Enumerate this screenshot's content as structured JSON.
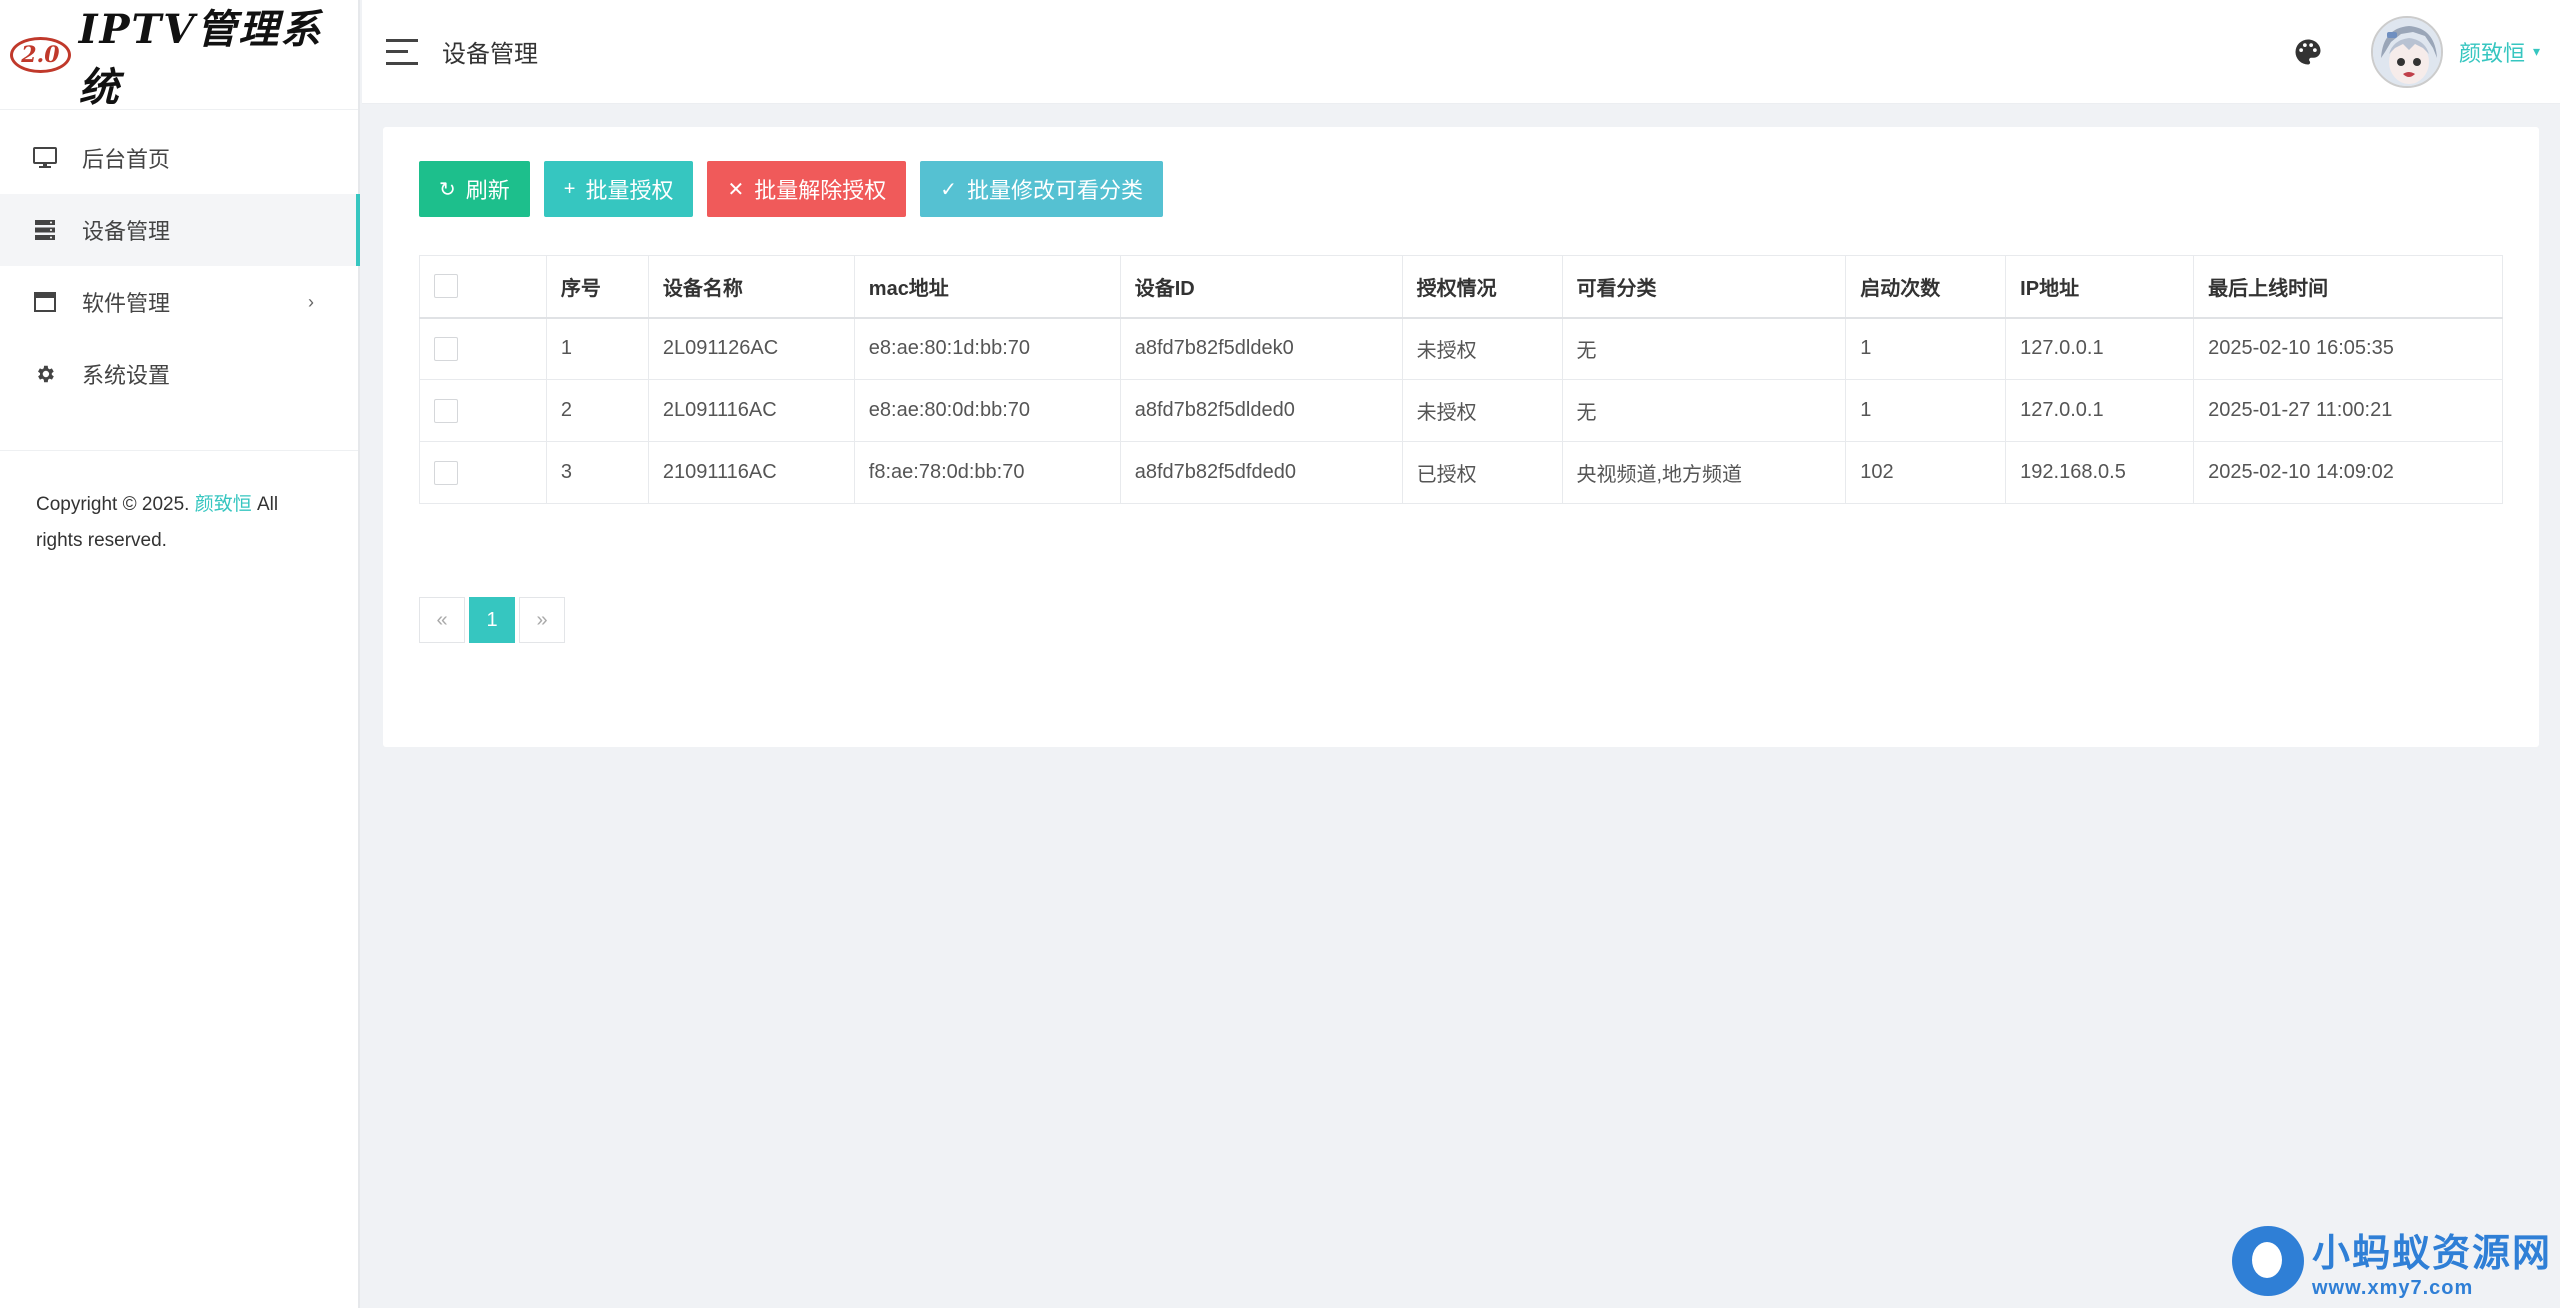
{
  "app": {
    "logo_badge": "2.0",
    "logo_text": "IPTV管理系统"
  },
  "sidebar": {
    "items": [
      {
        "label": "后台首页",
        "icon": "monitor-icon"
      },
      {
        "label": "设备管理",
        "icon": "server-icon",
        "active": true
      },
      {
        "label": "软件管理",
        "icon": "window-icon",
        "has_submenu": true
      },
      {
        "label": "系统设置",
        "icon": "gear-icon"
      }
    ],
    "submenu_caret": "›",
    "copyright_prefix": "Copyright © 2025.",
    "copyright_author": "颜致恒",
    "copyright_suffix": "All rights reserved."
  },
  "header": {
    "page_title": "设备管理",
    "user_name": "颜致恒",
    "user_caret": "▾"
  },
  "toolbar": {
    "refresh_icon": "↻",
    "refresh_label": "刷新",
    "batch_auth_icon": "+",
    "batch_auth_label": "批量授权",
    "batch_deauth_icon": "✕",
    "batch_deauth_label": "批量解除授权",
    "batch_modify_icon": "✓",
    "batch_modify_label": "批量修改可看分类"
  },
  "table": {
    "headers": [
      "序号",
      "设备名称",
      "mac地址",
      "设备ID",
      "授权情况",
      "可看分类",
      "启动次数",
      "IP地址",
      "最后上线时间"
    ],
    "rows": [
      {
        "no": "1",
        "name": "2L091126AC",
        "mac": "e8:ae:80:1d:bb:70",
        "device_id": "a8fd7b82f5dldek0",
        "auth": "未授权",
        "auth_ok": false,
        "category": "无",
        "boot_count": "1",
        "ip": "127.0.0.1",
        "last_online": "2025-02-10 16:05:35"
      },
      {
        "no": "2",
        "name": "2L091116AC",
        "mac": "e8:ae:80:0d:bb:70",
        "device_id": "a8fd7b82f5dlded0",
        "auth": "未授权",
        "auth_ok": false,
        "category": "无",
        "boot_count": "1",
        "ip": "127.0.0.1",
        "last_online": "2025-01-27 11:00:21"
      },
      {
        "no": "3",
        "name": "21091116AC",
        "mac": "f8:ae:78:0d:bb:70",
        "device_id": "a8fd7b82f5dfded0",
        "auth": "已授权",
        "auth_ok": true,
        "category": "央视频道,地方频道",
        "boot_count": "102",
        "ip": "192.168.0.5",
        "last_online": "2025-02-10 14:09:02"
      }
    ]
  },
  "pagination": {
    "prev": "«",
    "current": "1",
    "next": "»"
  },
  "watermark": {
    "name": "小蚂蚁资源网",
    "url": "www.xmy7.com"
  },
  "colors": {
    "accent": "#36c6c0",
    "refresh": "#1dbf8c",
    "danger": "#f05a5a",
    "modify": "#55c1d2",
    "unauthorized": "#f0a640",
    "authorized": "#1aa56e"
  }
}
